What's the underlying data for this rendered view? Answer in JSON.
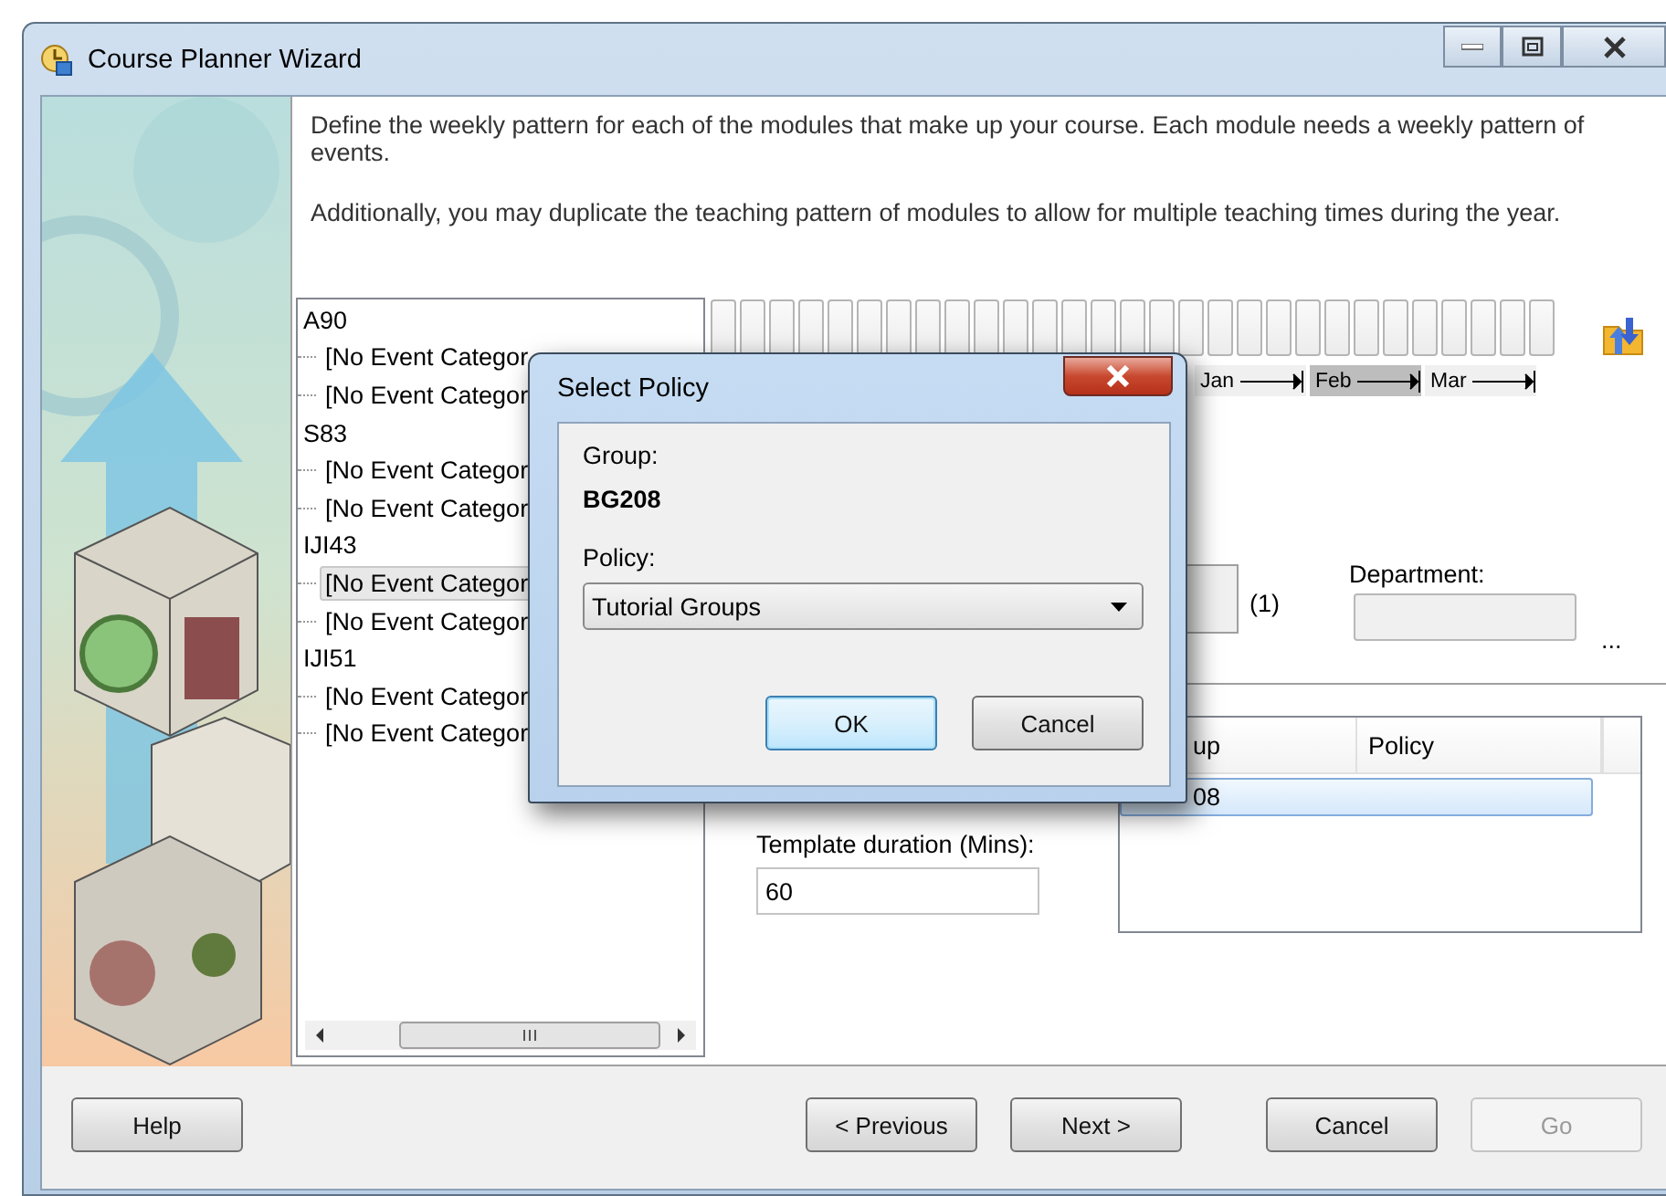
{
  "window": {
    "title": "Course Planner Wizard"
  },
  "intro": [
    "Define the weekly pattern for each of the modules that make up your course. Each module needs a weekly pattern of events.",
    "Additionally, you may duplicate the teaching pattern of modules to allow for multiple teaching times during the year."
  ],
  "tree": [
    {
      "label": "A90",
      "selected": false,
      "children": [
        {
          "label": "[No Event Categor",
          "selected": false
        },
        {
          "label": "[No Event Categor",
          "selected": false
        }
      ]
    },
    {
      "label": "S83",
      "selected": false,
      "children": [
        {
          "label": "[No Event Categor",
          "selected": false
        },
        {
          "label": "[No Event Categor",
          "selected": false
        }
      ]
    },
    {
      "label": "IJI43",
      "selected": false,
      "children": [
        {
          "label": "[No Event Categor",
          "selected": true
        },
        {
          "label": "[No Event Categor",
          "selected": false
        }
      ]
    },
    {
      "label": "IJI51",
      "selected": false,
      "children": [
        {
          "label": "[No Event Categor",
          "selected": false
        },
        {
          "label": "[No Event Categor",
          "selected": false
        }
      ]
    }
  ],
  "timeline": {
    "months": [
      {
        "label": "Jan",
        "selected": false
      },
      {
        "label": "Feb",
        "selected": true
      },
      {
        "label": "Mar",
        "selected": false
      }
    ]
  },
  "form": {
    "count_label": "(1)",
    "department": {
      "label": "Department:"
    },
    "browse_label": "...",
    "template_duration": {
      "label": "Template duration (Mins):",
      "value": "60"
    },
    "groups_table": {
      "columns": [
        "up",
        "Policy"
      ],
      "rows": [
        {
          "cells": [
            "08"
          ],
          "selected": true
        }
      ]
    }
  },
  "dialog": {
    "title": "Select Policy",
    "group_label": "Group:",
    "group_value": "BG208",
    "policy_label": "Policy:",
    "policy_value": "Tutorial Groups",
    "buttons": [
      {
        "label": "OK",
        "default": true
      },
      {
        "label": "Cancel",
        "default": false
      }
    ]
  },
  "buttons": [
    {
      "label": "Help",
      "disabled": false
    },
    {
      "label": "< Previous",
      "disabled": false
    },
    {
      "label": "Next >",
      "disabled": false
    },
    {
      "label": "Cancel",
      "disabled": false
    },
    {
      "label": "Go",
      "disabled": true
    }
  ]
}
